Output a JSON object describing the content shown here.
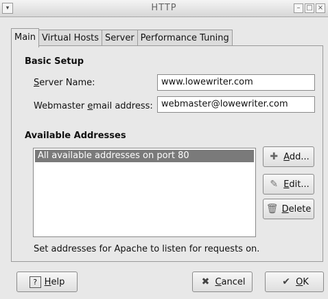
{
  "window": {
    "title": "HTTP",
    "menu_icon": "chevron-down-icon"
  },
  "tabs": [
    {
      "label": "Main"
    },
    {
      "label": "Virtual Hosts"
    },
    {
      "label": "Server"
    },
    {
      "label": "Performance Tuning"
    }
  ],
  "basic_setup": {
    "heading": "Basic Setup",
    "server_name_label_u": "S",
    "server_name_label_rest": "erver Name:",
    "server_name_value": "www.lowewriter.com",
    "webmaster_label_pre": "Webmaster ",
    "webmaster_label_u": "e",
    "webmaster_label_rest": "mail address:",
    "webmaster_value": "webmaster@lowewriter.com"
  },
  "addresses": {
    "heading": "Available Addresses",
    "items": [
      "All available addresses on port 80"
    ],
    "add_u": "A",
    "add_rest": "dd...",
    "edit_u": "E",
    "edit_rest": "dit...",
    "delete_u": "D",
    "delete_rest": "elete",
    "hint": "Set addresses for Apache to listen for requests on."
  },
  "footer": {
    "help_u": "H",
    "help_rest": "elp",
    "cancel_u": "C",
    "cancel_rest": "ancel",
    "ok_u": "O",
    "ok_rest": "K"
  }
}
